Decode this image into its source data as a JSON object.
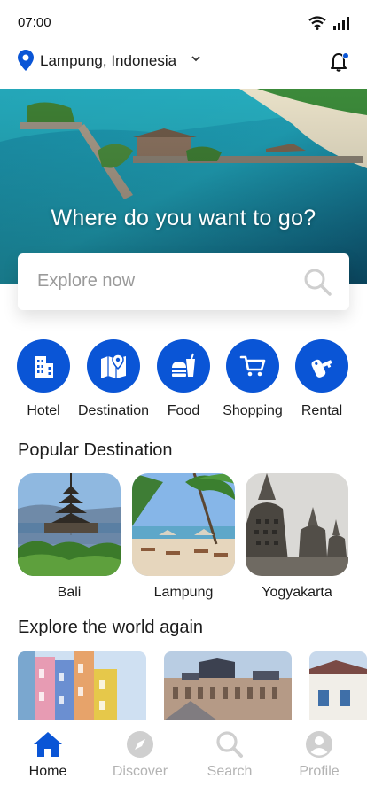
{
  "status": {
    "time": "07:00"
  },
  "location": {
    "label": "Lampung, Indonesia"
  },
  "hero": {
    "title": "Where do you want to go?"
  },
  "search": {
    "placeholder": "Explore now"
  },
  "categories": [
    {
      "label": "Hotel",
      "icon": "hotel-icon"
    },
    {
      "label": "Destination",
      "icon": "map-icon"
    },
    {
      "label": "Food",
      "icon": "food-icon"
    },
    {
      "label": "Shopping",
      "icon": "cart-icon"
    },
    {
      "label": "Rental",
      "icon": "key-icon"
    }
  ],
  "popular": {
    "title": "Popular Destination",
    "items": [
      {
        "label": "Bali"
      },
      {
        "label": "Lampung"
      },
      {
        "label": "Yogyakarta"
      }
    ]
  },
  "explore": {
    "title": "Explore the world again"
  },
  "nav": [
    {
      "label": "Home",
      "icon": "home-icon",
      "active": true
    },
    {
      "label": "Discover",
      "icon": "compass-icon"
    },
    {
      "label": "Search",
      "icon": "search-icon"
    },
    {
      "label": "Profile",
      "icon": "profile-icon"
    }
  ],
  "colors": {
    "accent": "#0a55d6",
    "inactive": "#b3b3b3",
    "text": "#1c1c1c"
  }
}
